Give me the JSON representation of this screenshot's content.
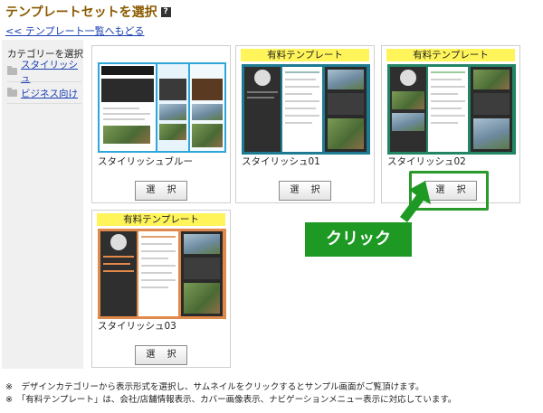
{
  "header": {
    "title": "テンプレートセットを選択",
    "back_link": "<< テンプレート一覧へもどる"
  },
  "sidebar": {
    "title": "カテゴリーを選択",
    "items": [
      {
        "label": "スタイリッシュ"
      },
      {
        "label": "ビジネス向け"
      }
    ]
  },
  "templates": [
    {
      "name": "スタイリッシュブルー",
      "badge": "",
      "button": "選 択"
    },
    {
      "name": "スタイリッシュ01",
      "badge": "有料テンプレート",
      "button": "選 択"
    },
    {
      "name": "スタイリッシュ02",
      "badge": "有料テンプレート",
      "button": "選 択"
    },
    {
      "name": "スタイリッシュ03",
      "badge": "有料テンプレート",
      "button": "選 択"
    }
  ],
  "annotation": {
    "label": "クリック",
    "color": "#1e9a24"
  },
  "notes": [
    "※　デザインカテゴリーから表示形式を選択し、サムネイルをクリックするとサンプル画面がご覧頂けます。",
    "※　「有料テンプレート」は、会社/店舗情報表示、カバー画像表示、ナビゲーションメニュー表示に対応しています。"
  ],
  "colors": {
    "accent_title": "#8a5a00",
    "link": "#1a3fb3",
    "paid_badge": "#fff45a"
  }
}
